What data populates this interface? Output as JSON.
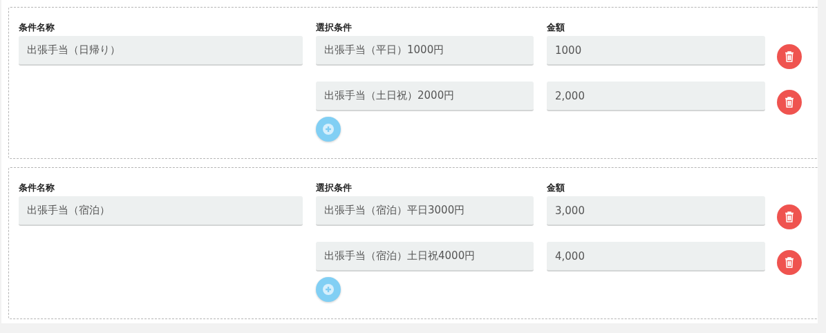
{
  "groups": [
    {
      "name_label": "条件名称",
      "name_value": "出張手当（日帰り）",
      "condition_label": "選択条件",
      "amount_label": "金額",
      "rows": [
        {
          "condition": "出張手当（平日）1000円",
          "amount": "1000"
        },
        {
          "condition": "出張手当（土日祝）2000円",
          "amount": "2,000"
        }
      ]
    },
    {
      "name_label": "条件名称",
      "name_value": "出張手当（宿泊）",
      "condition_label": "選択条件",
      "amount_label": "金額",
      "rows": [
        {
          "condition": "出張手当（宿泊）平日3000円",
          "amount": "3,000"
        },
        {
          "condition": "出張手当（宿泊）土日祝4000円",
          "amount": "4,000"
        }
      ]
    }
  ]
}
